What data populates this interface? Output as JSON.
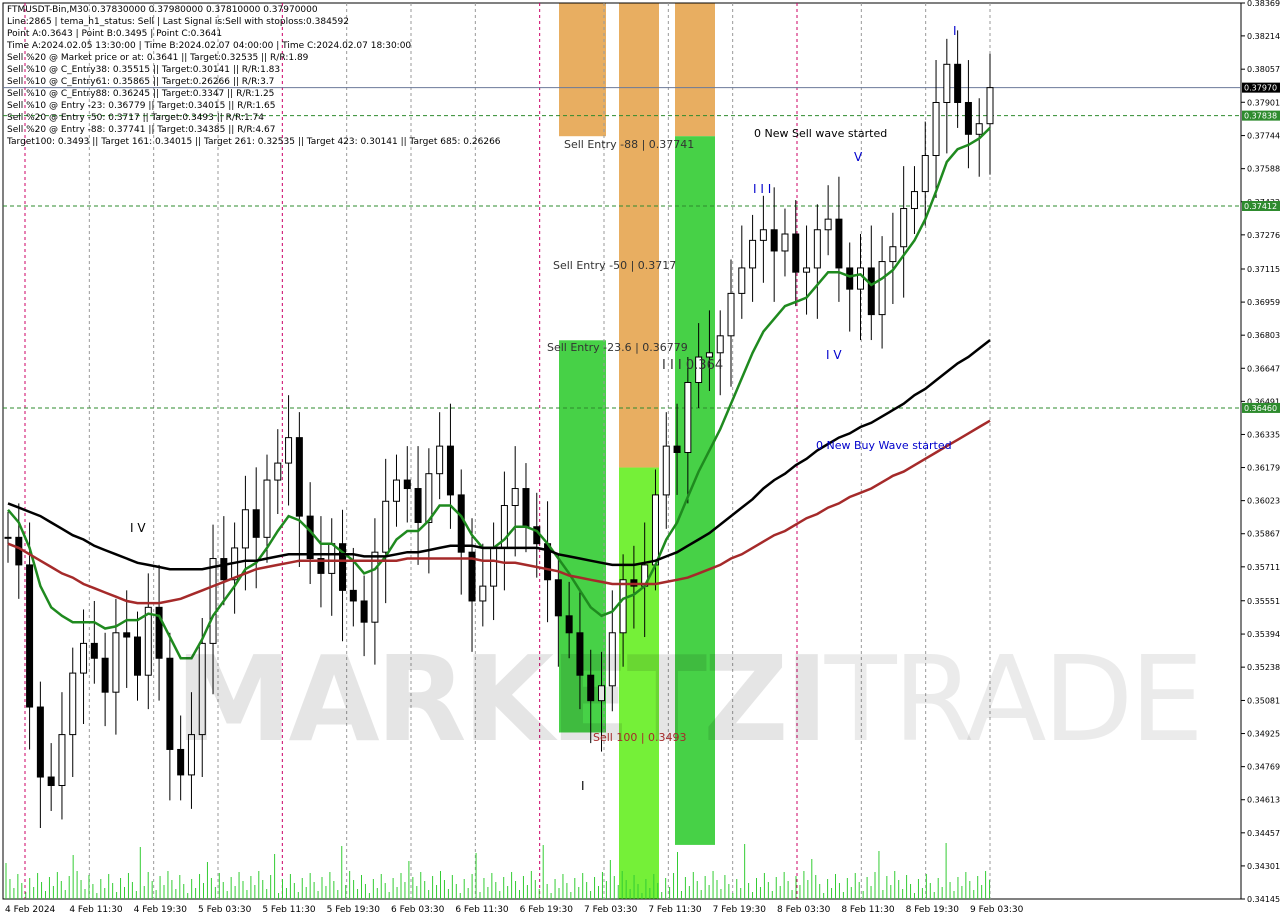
{
  "header": {
    "lines": [
      "FTMUSDT-Bin,M30  0.37830000 0.37980000 0.37810000 0.37970000",
      "Line:2865  | tema_h1_status: Sell  | Last Signal is:Sell with stoploss:0.384592",
      "Point A:0.3643  | Point B:0.3495  | Point C:0.3641",
      "Time A:2024.02.05 13:30:00  | Time B:2024.02.07 04:00:00  | Time C:2024.02.07 18:30:00",
      "Sell %20 @ Market price or at: 0.3641  || Target:0.32535  || R/R:1.89",
      "Sell %10 @ C_Entry38: 0.35515  || Target:0.30141  || R/R:1.83",
      "Sell %10 @ C_Entry61: 0.35865  || Target:0.26266  || R/R:3.7",
      "Sell %10 @ C_Entry88: 0.36245  || Target:0.3347  || R/R:1.25",
      "Sell %10 @ Entry -23: 0.36779  || Target:0.34015  || R/R:1.65",
      "Sell %20 @ Entry -50: 0.3717  || Target:0.3493  || R/R:1.74",
      "Sell %20 @ Entry -88: 0.37741  || Target:0.34385  || R/R:4.67",
      "Target100: 0.3493  || Target 161: 0.34015  || Target 261: 0.32535  || Target 423: 0.30141  || Target 685: 0.26266"
    ]
  },
  "annotations": {
    "sell_entry_88": "Sell Entry -88 | 0.37741",
    "sell_entry_50": "Sell Entry -50 | 0.3717",
    "sell_entry_23": "Sell Entry -23.6 | 0.36779",
    "point_c": "I I I 0.364",
    "sell_100": "Sell 100 | 0.3493",
    "new_sell_wave": "0 New Sell wave started",
    "new_buy_wave": "0 New Buy Wave started",
    "wave_iv_left": "I V",
    "wave_iii": "I I I",
    "wave_v_top": "V",
    "wave_i_top": "I",
    "wave_iv_mid": "I V",
    "wave_i_bottom": "I"
  },
  "watermark": {
    "bold": "MARKETZI",
    "thin": "TRADE"
  },
  "colors": {
    "background": "#ffffff",
    "candle": "#000000",
    "ema_green": "#1f8a1f",
    "ema_black": "#000000",
    "ema_red": "#a52a2a",
    "zone_orange": "#e6a550",
    "zone_green": "#33cc33",
    "zone_lime": "#66ee22",
    "hline_green": "#2e8b2e",
    "vline_magenta": "#cc0066",
    "arrow_up": "#0000ff",
    "arrow_down": "#ff0000",
    "current_price_tag": "#000000",
    "level_tag": "#2e8b2e"
  },
  "chart_data": {
    "type": "candlestick",
    "symbol": "FTMUSDT-Bin",
    "timeframe": "M30",
    "ylim": [
      0.34145,
      0.38369
    ],
    "y_ticks": [
      "0.38369",
      "0.38214",
      "0.38057",
      "0.37901",
      "0.37744",
      "0.37588",
      "0.37432",
      "0.37276",
      "0.37115",
      "0.36959",
      "0.36803",
      "0.36647",
      "0.36491",
      "0.36335",
      "0.36179",
      "0.36023",
      "0.35867",
      "0.35711",
      "0.35551",
      "0.35394",
      "0.35238",
      "0.35081",
      "0.34925",
      "0.34769",
      "0.34613",
      "0.34457",
      "0.34301",
      "0.34145"
    ],
    "x_ticks": [
      "4 Feb 2024",
      "4 Feb 11:30",
      "4 Feb 19:30",
      "5 Feb 03:30",
      "5 Feb 11:30",
      "5 Feb 19:30",
      "6 Feb 03:30",
      "6 Feb 11:30",
      "6 Feb 19:30",
      "7 Feb 03:30",
      "7 Feb 11:30",
      "7 Feb 19:30",
      "8 Feb 03:30",
      "8 Feb 11:30",
      "8 Feb 19:30",
      "9 Feb 03:30"
    ],
    "price_tags": [
      {
        "label": "0.37970",
        "value": 0.3797,
        "kind": "current"
      },
      {
        "label": "0.37838",
        "value": 0.37838,
        "kind": "level"
      },
      {
        "label": "0.37412",
        "value": 0.37412,
        "kind": "level"
      },
      {
        "label": "0.36460",
        "value": 0.3646,
        "kind": "level"
      }
    ],
    "horizontal_levels": [
      0.3797,
      0.37838,
      0.37412,
      0.3646
    ],
    "zones": [
      {
        "from": 0.37741,
        "to": 0.38369,
        "color": "orange",
        "column": 0
      },
      {
        "from": 0.3493,
        "to": 0.36779,
        "color": "green",
        "column": 0
      },
      {
        "from": 0.36179,
        "to": 0.38369,
        "color": "orange",
        "column": 1
      },
      {
        "from": 0.34145,
        "to": 0.36179,
        "color": "green",
        "column": 1
      },
      {
        "from": 0.37741,
        "to": 0.38369,
        "color": "orange",
        "column": 2
      },
      {
        "from": 0.344,
        "to": 0.37741,
        "color": "green",
        "column": 2
      }
    ],
    "series": [
      {
        "name": "",
        "values": [
          0.3585,
          0.3572,
          0.3505,
          0.3472,
          0.3468,
          0.3492,
          0.3521,
          0.3535,
          0.3528,
          0.3512,
          0.354,
          0.3538,
          0.352,
          0.3552,
          0.3528,
          0.3485,
          0.3473,
          0.3492,
          0.3535,
          0.3575,
          0.3565,
          0.358,
          0.3598,
          0.3585,
          0.3612,
          0.362,
          0.3632,
          0.3595,
          0.3575,
          0.3568,
          0.3582,
          0.356,
          0.3555,
          0.3545,
          0.3578,
          0.3602,
          0.3612,
          0.3608,
          0.3592,
          0.3615,
          0.3628,
          0.3605,
          0.3578,
          0.3555,
          0.3562,
          0.358,
          0.36,
          0.3608,
          0.359,
          0.3582,
          0.3565,
          0.3548,
          0.354,
          0.352,
          0.3508,
          0.3515,
          0.354,
          0.3565,
          0.3562,
          0.3572,
          0.3605,
          0.3628,
          0.3625,
          0.3658,
          0.367,
          0.3672,
          0.368,
          0.37,
          0.3712,
          0.3725,
          0.373,
          0.372,
          0.3728,
          0.371,
          0.3712,
          0.373,
          0.3735,
          0.3712,
          0.3702,
          0.3712,
          0.369,
          0.3715,
          0.3722,
          0.374,
          0.3748,
          0.3765,
          0.379,
          0.3808,
          0.379,
          0.3775,
          0.378,
          0.3797
        ]
      },
      {
        "name": "",
        "values": [
          0.3598,
          0.3592,
          0.358,
          0.3562,
          0.3552,
          0.3548,
          0.3545,
          0.3545,
          0.3545,
          0.3542,
          0.3543,
          0.3546,
          0.3546,
          0.3549,
          0.3548,
          0.3538,
          0.3528,
          0.3528,
          0.3537,
          0.3548,
          0.3555,
          0.3562,
          0.357,
          0.3573,
          0.358,
          0.3588,
          0.3595,
          0.3593,
          0.3588,
          0.3582,
          0.3582,
          0.3578,
          0.3574,
          0.3568,
          0.357,
          0.3576,
          0.3584,
          0.3588,
          0.3588,
          0.3593,
          0.36,
          0.36,
          0.3595,
          0.3586,
          0.358,
          0.358,
          0.3584,
          0.359,
          0.359,
          0.3588,
          0.3582,
          0.3575,
          0.3568,
          0.356,
          0.3552,
          0.3548,
          0.355,
          0.3556,
          0.3558,
          0.3562,
          0.3572,
          0.3584,
          0.3592,
          0.3604,
          0.3616,
          0.3626,
          0.3636,
          0.3648,
          0.366,
          0.3672,
          0.3682,
          0.3688,
          0.3694,
          0.3696,
          0.3698,
          0.3704,
          0.371,
          0.371,
          0.3708,
          0.3709,
          0.3704,
          0.3707,
          0.3711,
          0.3718,
          0.3725,
          0.3735,
          0.3748,
          0.3762,
          0.3768,
          0.377,
          0.3773,
          0.3778
        ]
      },
      {
        "name": "",
        "values": [
          0.3601,
          0.3599,
          0.3597,
          0.3595,
          0.3592,
          0.3589,
          0.3586,
          0.3584,
          0.3581,
          0.3579,
          0.3577,
          0.3575,
          0.3573,
          0.3572,
          0.3571,
          0.357,
          0.357,
          0.357,
          0.357,
          0.3571,
          0.3572,
          0.3573,
          0.3574,
          0.3574,
          0.3575,
          0.3576,
          0.3577,
          0.3577,
          0.3577,
          0.3577,
          0.3577,
          0.3577,
          0.3577,
          0.3576,
          0.3576,
          0.3576,
          0.3577,
          0.3578,
          0.3578,
          0.3579,
          0.358,
          0.3581,
          0.3581,
          0.3581,
          0.358,
          0.358,
          0.358,
          0.358,
          0.358,
          0.358,
          0.3579,
          0.3577,
          0.3576,
          0.3575,
          0.3574,
          0.3573,
          0.3572,
          0.3572,
          0.3572,
          0.3573,
          0.3574,
          0.3576,
          0.3578,
          0.3581,
          0.3584,
          0.3587,
          0.3591,
          0.3595,
          0.3599,
          0.3603,
          0.3608,
          0.3612,
          0.3615,
          0.3619,
          0.3622,
          0.3626,
          0.3629,
          0.3632,
          0.3634,
          0.3637,
          0.3639,
          0.3642,
          0.3645,
          0.3648,
          0.3652,
          0.3655,
          0.3659,
          0.3663,
          0.3667,
          0.367,
          0.3674,
          0.3678
        ]
      },
      {
        "name": "",
        "values": [
          0.3582,
          0.358,
          0.3577,
          0.3574,
          0.3571,
          0.3568,
          0.3566,
          0.3563,
          0.3561,
          0.3559,
          0.3557,
          0.3555,
          0.3554,
          0.3554,
          0.3554,
          0.3555,
          0.3556,
          0.3558,
          0.356,
          0.3562,
          0.3564,
          0.3566,
          0.3568,
          0.357,
          0.3571,
          0.3572,
          0.3573,
          0.3574,
          0.3574,
          0.3574,
          0.3574,
          0.3574,
          0.3574,
          0.3574,
          0.3574,
          0.3574,
          0.3574,
          0.3575,
          0.3575,
          0.3575,
          0.3575,
          0.3575,
          0.3575,
          0.3575,
          0.3574,
          0.3574,
          0.3573,
          0.3573,
          0.3572,
          0.3571,
          0.357,
          0.3569,
          0.3567,
          0.3566,
          0.3565,
          0.3564,
          0.3563,
          0.3563,
          0.3563,
          0.3563,
          0.3563,
          0.3564,
          0.3565,
          0.3566,
          0.3568,
          0.357,
          0.3572,
          0.3575,
          0.3577,
          0.358,
          0.3583,
          0.3586,
          0.3588,
          0.3591,
          0.3594,
          0.3596,
          0.3599,
          0.3601,
          0.3604,
          0.3606,
          0.3608,
          0.3611,
          0.3614,
          0.3616,
          0.3619,
          0.3622,
          0.3625,
          0.3628,
          0.3631,
          0.3634,
          0.3637,
          0.364
        ]
      }
    ],
    "legend": "none",
    "grid": false
  }
}
